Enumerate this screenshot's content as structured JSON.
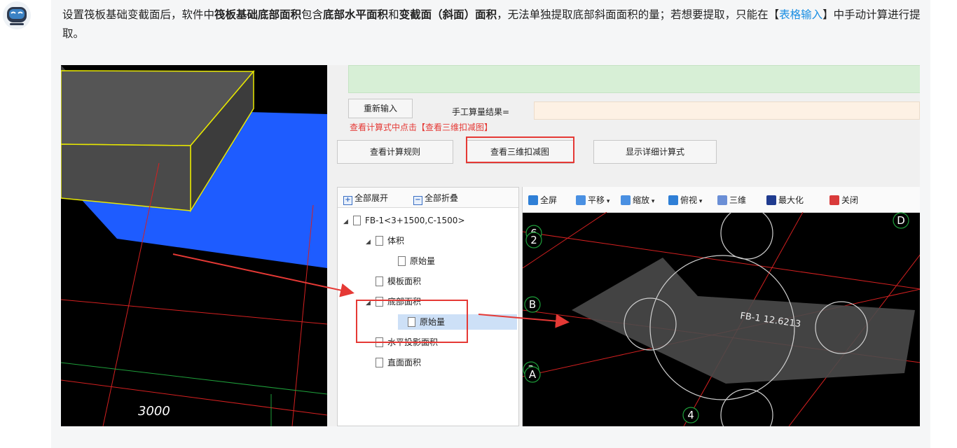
{
  "message": {
    "segments": [
      {
        "text": "设置筏板基础变截面后，软件中",
        "style": "normal"
      },
      {
        "text": "筏板基础底部面积",
        "style": "bold"
      },
      {
        "text": "包含",
        "style": "normal"
      },
      {
        "text": "底部水平面积",
        "style": "bold"
      },
      {
        "text": "和",
        "style": "normal"
      },
      {
        "text": "变截面（斜面）面积",
        "style": "bold"
      },
      {
        "text": "，无法单独提取底部斜面面积的量；若想要提取，只能在【",
        "style": "normal"
      },
      {
        "text": "表格输入",
        "style": "link"
      },
      {
        "text": "】中手动计算进行提取。",
        "style": "normal"
      }
    ]
  },
  "screenshot": {
    "left_view": {
      "dimension_label": "3000"
    },
    "form": {
      "reenter_button": "重新输入",
      "manual_result_label": "手工算量结果=",
      "manual_result_value": "",
      "note": "查看计算式中点击【查看三维扣减图】",
      "buttons": {
        "view_rules": "查看计算规则",
        "view_3d_deduction": "查看三维扣减图",
        "show_detail_formula": "显示详细计算式"
      }
    },
    "tree": {
      "expand_all": "全部展开",
      "collapse_all": "全部折叠",
      "nodes": [
        {
          "label": "FB-1<3+1500,C-1500>",
          "level": 0,
          "expanded": true
        },
        {
          "label": "体积",
          "level": 1,
          "expanded": true
        },
        {
          "label": "原始量",
          "level": 2
        },
        {
          "label": "模板面积",
          "level": 1
        },
        {
          "label": "底部面积",
          "level": 1,
          "expanded": true,
          "highlighted": true
        },
        {
          "label": "原始量",
          "level": 2,
          "selected": true,
          "highlighted": true
        },
        {
          "label": "水平投影面积",
          "level": 1
        },
        {
          "label": "直面面积",
          "level": 1
        }
      ]
    },
    "viewer": {
      "toolbar": [
        {
          "label": "全屏",
          "icon": "fullscreen-icon"
        },
        {
          "label": "平移",
          "icon": "pan-icon",
          "dropdown": true
        },
        {
          "label": "缩放",
          "icon": "zoom-icon",
          "dropdown": true
        },
        {
          "label": "俯视",
          "icon": "top-view-icon",
          "dropdown": true
        },
        {
          "label": "三维",
          "icon": "3d-icon"
        },
        {
          "label": "最大化",
          "icon": "maximize-icon"
        },
        {
          "label": "关闭",
          "icon": "close-icon"
        }
      ],
      "axis_labels": [
        "6",
        "2",
        "D",
        "B",
        "3",
        "A",
        "4"
      ],
      "shape_label": "FB-1 12.6213"
    }
  },
  "colors": {
    "highlight_red": "#e53935",
    "link_blue": "#1a8fe3",
    "slab_blue": "#1e5cff",
    "wire_yellow": "#e8e800",
    "grid_red": "#d42020",
    "grid_green": "#1e9e3a"
  }
}
